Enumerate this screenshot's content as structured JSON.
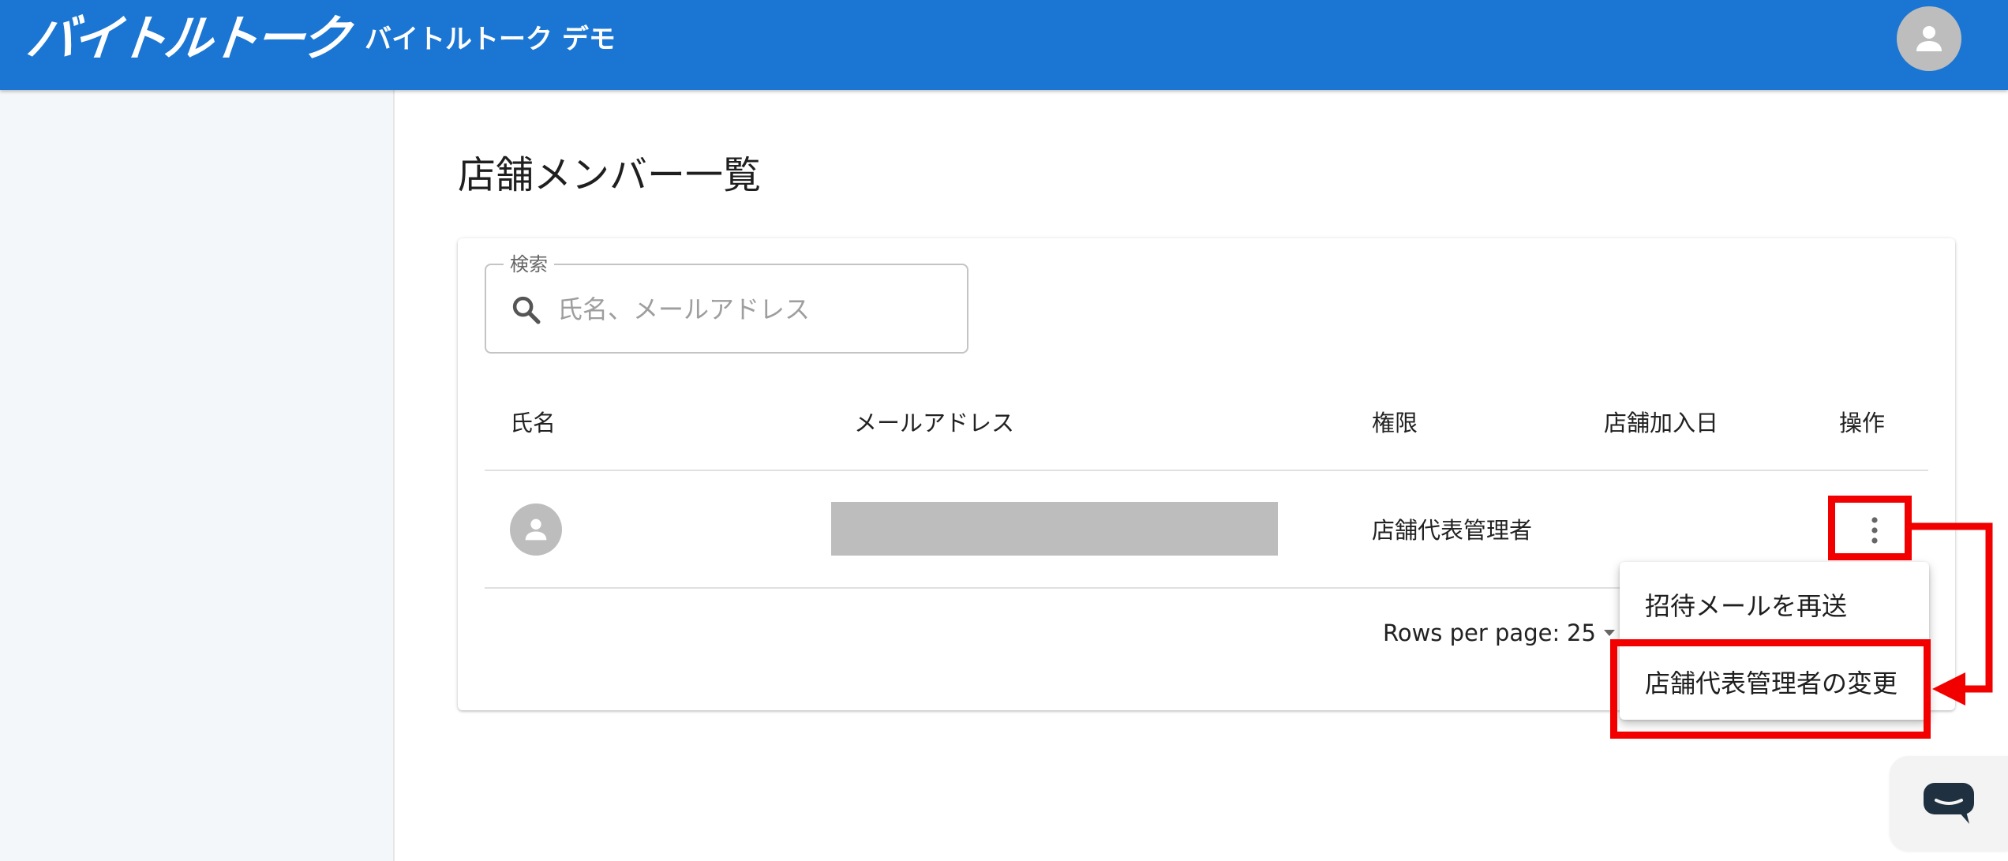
{
  "header": {
    "logo_text": "バイトルトーク",
    "subtitle": "バイトルトーク デモ",
    "avatar_icon": "person-icon",
    "bar_color": "#1b76d3"
  },
  "page": {
    "title": "店舗メンバー一覧"
  },
  "search": {
    "label": "検索",
    "placeholder": "氏名、メールアドレス",
    "value": ""
  },
  "table": {
    "columns": [
      "氏名",
      "メールアドレス",
      "権限",
      "店舗加入日",
      "操作"
    ],
    "rows": [
      {
        "avatar_icon": "person-icon",
        "email": "",
        "role": "店舗代表管理者",
        "joined": ""
      }
    ]
  },
  "pagination": {
    "rows_per_page_label": "Rows per page:",
    "rows_per_page_value": "25"
  },
  "row_menu": {
    "items": [
      "招待メールを再送",
      "店舗代表管理者の変更"
    ],
    "highlighted_index": 1
  },
  "annotation_color": "#f20000"
}
